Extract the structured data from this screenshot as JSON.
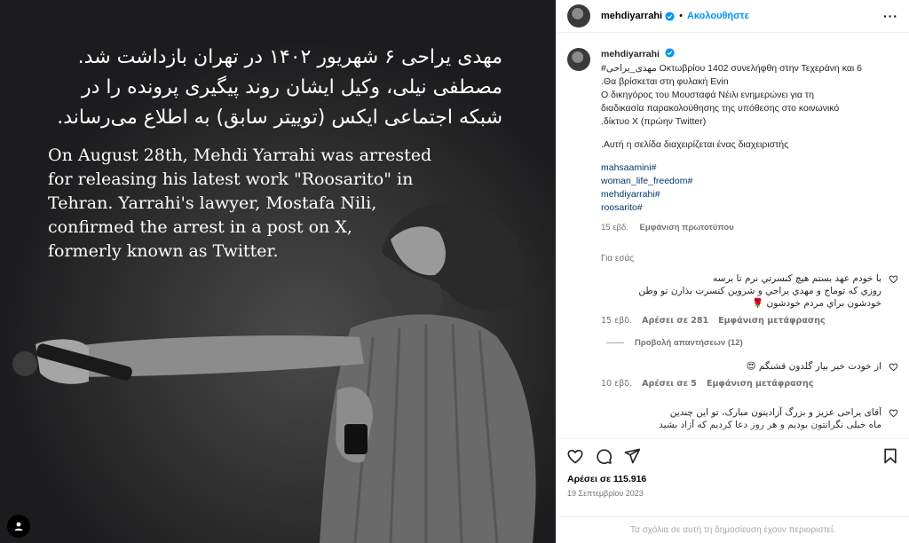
{
  "post": {
    "persian_lines": [
      "مهدی یراحی ۶ شهریور ۱۴۰۲ در تهران بازداشت شد.",
      "مصطفی نیلی، وکیل ایشان روند پیگیری پرونده را در",
      "شبکه اجتماعی ایکس (توییتر سابق) به اطلاع می‌رساند."
    ],
    "english_lines": [
      "On August 28th, Mehdi Yarrahi was arrested",
      "for releasing his latest work \"Roosarito\" in",
      "Tehran. Yarrahi's lawyer, Mostafa Nili,",
      "confirmed the arrest in a post on X,",
      "formerly known as Twitter."
    ]
  },
  "header": {
    "username": "mehdiyarrahi",
    "separator": "•",
    "follow_label": "Ακολουθήστε",
    "more_label": "···"
  },
  "caption": {
    "username": "mehdiyarrahi",
    "line1": "#مهدی_یراحی Οκτωβρίου 1402 συνελήφθη στην Τεχεράνη και 6",
    "line2": ".Θα βρίσκεται στη φυλακή Evin",
    "line3": "Ο δικηγόρος του Μουσταφά Νέιλι ενημερώνει για τη",
    "line4": "διαδικασία παρακολούθησης της υπόθεσης στο κοινωνικό",
    "line5": ".δίκτυο X (πρώην Twitter)",
    "line6": ".Αυτή η σελίδα διαχειρίζεται ένας διαχειριστής",
    "hashtags": [
      "mahsaamini#",
      "woman_life_freedom#",
      "mehdiyarrahi#",
      "roosarito#"
    ],
    "age": "15 εβδ.",
    "see_translation": "Εμφάνιση πρωτοτύπου"
  },
  "hint": "Για εσάς",
  "comments": [
    {
      "lines": [
        "با خودم عهد بستم هيچ كنسرتي نرم تا برسه",
        "روزي كه توماج و مهدي يراحي و شروين كنسرت بذارن تو وطن",
        "خودشون براي مردم خودشون 🌹"
      ],
      "age": "15 εβδ.",
      "likes": "Αρέσει σε 281",
      "translate": "Εμφάνιση μετάφρασης"
    },
    {
      "lines": [
        "از خودت خبر بیار گلدون قشنگم 😍"
      ],
      "age": "10 εβδ.",
      "likes": "Αρέσει σε 5",
      "translate": "Εμφάνιση μετάφρασης"
    },
    {
      "lines": [
        "آقای یراحی عزیز و بزرگ آزادیتون مبارک، تو این چندین",
        "ماه خیلی نگرانتون بودیم و هر روز دعا کردیم که آزاد بشید"
      ],
      "age": "",
      "likes": "",
      "translate": ""
    }
  ],
  "replies_label": "Προβολή απαντήσεων (12)",
  "likes_label": "Αρέσει σε 115.916",
  "date_label": "19 Σεπτεμβρίου 2023",
  "comments_limited": "Τα σχόλια σε αυτή τη δημοσίευση έχουν περιοριστεί.",
  "colors": {
    "accent": "#0095f6",
    "media_bg": "#1c1c1e",
    "muted": "#737373"
  }
}
